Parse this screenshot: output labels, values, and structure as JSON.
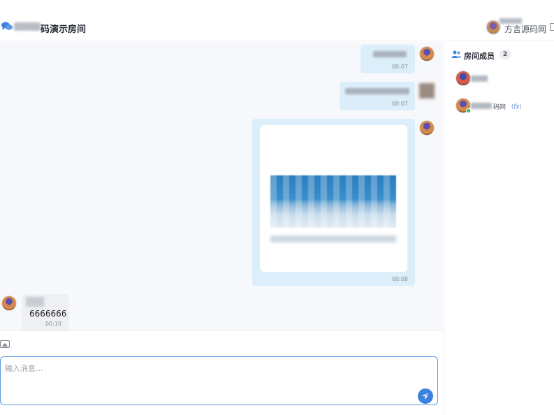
{
  "header": {
    "title": "码演示房间",
    "user_name": "方言源码网"
  },
  "messages": [
    {
      "direction": "out",
      "time": "00:07"
    },
    {
      "direction": "out",
      "time": "00:07"
    },
    {
      "direction": "out",
      "type": "image",
      "time": "00:08"
    },
    {
      "direction": "in",
      "text": "6666666",
      "time": "00:10"
    }
  ],
  "toolbar": {
    "image_icon": "image-icon"
  },
  "input": {
    "placeholder": "输入消息..."
  },
  "sidebar": {
    "title": "房间成员",
    "count": "2",
    "members": [
      {
        "name": ""
      },
      {
        "name": "码网",
        "tag": "(你)",
        "online": true
      }
    ]
  },
  "colors": {
    "accent": "#3b82e0",
    "bubble_out": "#ddeefb",
    "online": "#22c55e"
  }
}
